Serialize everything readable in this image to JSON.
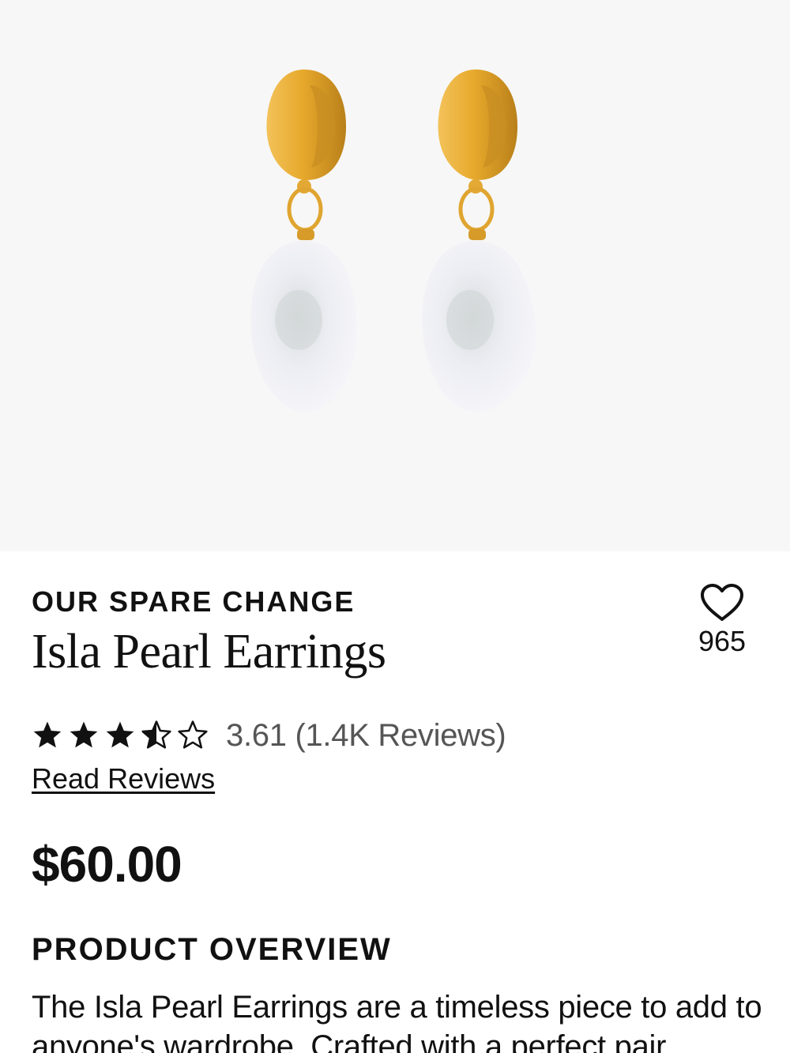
{
  "product": {
    "brand": "OUR SPARE CHANGE",
    "title": "Isla Pearl Earrings",
    "favorites_count": "965",
    "rating": {
      "value": 3.61,
      "max": 5,
      "text": "3.61 (1.4K Reviews)"
    },
    "read_reviews_label": "Read Reviews",
    "price": "$60.00",
    "overview": {
      "heading": "PRODUCT OVERVIEW",
      "text": "The Isla Pearl Earrings are a timeless piece to add to anyone's wardrobe. Crafted with a perfect pair"
    }
  },
  "icons": {
    "favorite": "heart-outline-icon",
    "star_full": "star-filled-icon",
    "star_half": "star-half-icon",
    "star_empty": "star-outline-icon"
  },
  "colors": {
    "hero_background": "#f7f7f7",
    "gold": "#e0a530",
    "pearl": "#eef0f4",
    "text": "#111111",
    "muted_text": "#555555"
  }
}
